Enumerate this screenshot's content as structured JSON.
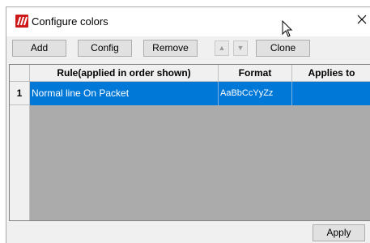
{
  "window": {
    "title": "Configure colors"
  },
  "toolbar": {
    "add_label": "Add",
    "config_label": "Config",
    "remove_label": "Remove",
    "up_label": "▲",
    "down_label": "▼",
    "clone_label": "Clone"
  },
  "table": {
    "columns": [
      "Rule(applied in order shown)",
      "Format",
      "Applies to"
    ],
    "rows": [
      {
        "index": "1",
        "rule": "Normal line  On Packet",
        "format": "AaBbCcYyZz",
        "applies_to": ""
      }
    ],
    "selection_color": "#0078d7"
  },
  "footer": {
    "apply_label": "Apply"
  },
  "colors": {
    "app_icon": "#cc1818",
    "button_face": "#e1e1e1",
    "grid_background": "#ababab"
  }
}
